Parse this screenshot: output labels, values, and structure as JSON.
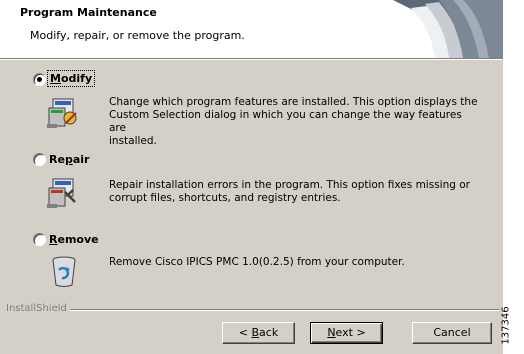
{
  "header": {
    "title": "Program Maintenance",
    "subtitle": "Modify, repair, or remove the program."
  },
  "options": [
    {
      "id": "modify",
      "label_prefix": "",
      "label_accel": "M",
      "label_rest": "odify",
      "selected": true,
      "description_lines": [
        "Change which program features are installed. This option displays the",
        "Custom Selection dialog in which you can change the way features are",
        "installed."
      ],
      "icon": "modify-program-icon"
    },
    {
      "id": "repair",
      "label_prefix": "Re",
      "label_accel": "p",
      "label_rest": "air",
      "selected": false,
      "description_lines": [
        "Repair installation errors in the program. This option fixes missing or",
        "corrupt files, shortcuts, and registry entries."
      ],
      "icon": "repair-program-icon"
    },
    {
      "id": "remove",
      "label_prefix": "",
      "label_accel": "R",
      "label_rest": "emove",
      "selected": false,
      "description_lines": [
        "Remove Cisco IPICS PMC 1.0(0.2.5) from your computer."
      ],
      "icon": "recycle-bin-icon"
    }
  ],
  "footer": {
    "brand": "InstallShield",
    "buttons": {
      "back": {
        "prefix": "< ",
        "accel": "B",
        "rest": "ack"
      },
      "next": {
        "prefix": "",
        "accel": "N",
        "rest": "ext >"
      },
      "cancel": {
        "label": "Cancel"
      }
    }
  },
  "side_figure_id": "137346",
  "colors": {
    "dialog_face": "#d4d0c8",
    "header_bg": "#ffffff",
    "shadow": "#808080"
  }
}
